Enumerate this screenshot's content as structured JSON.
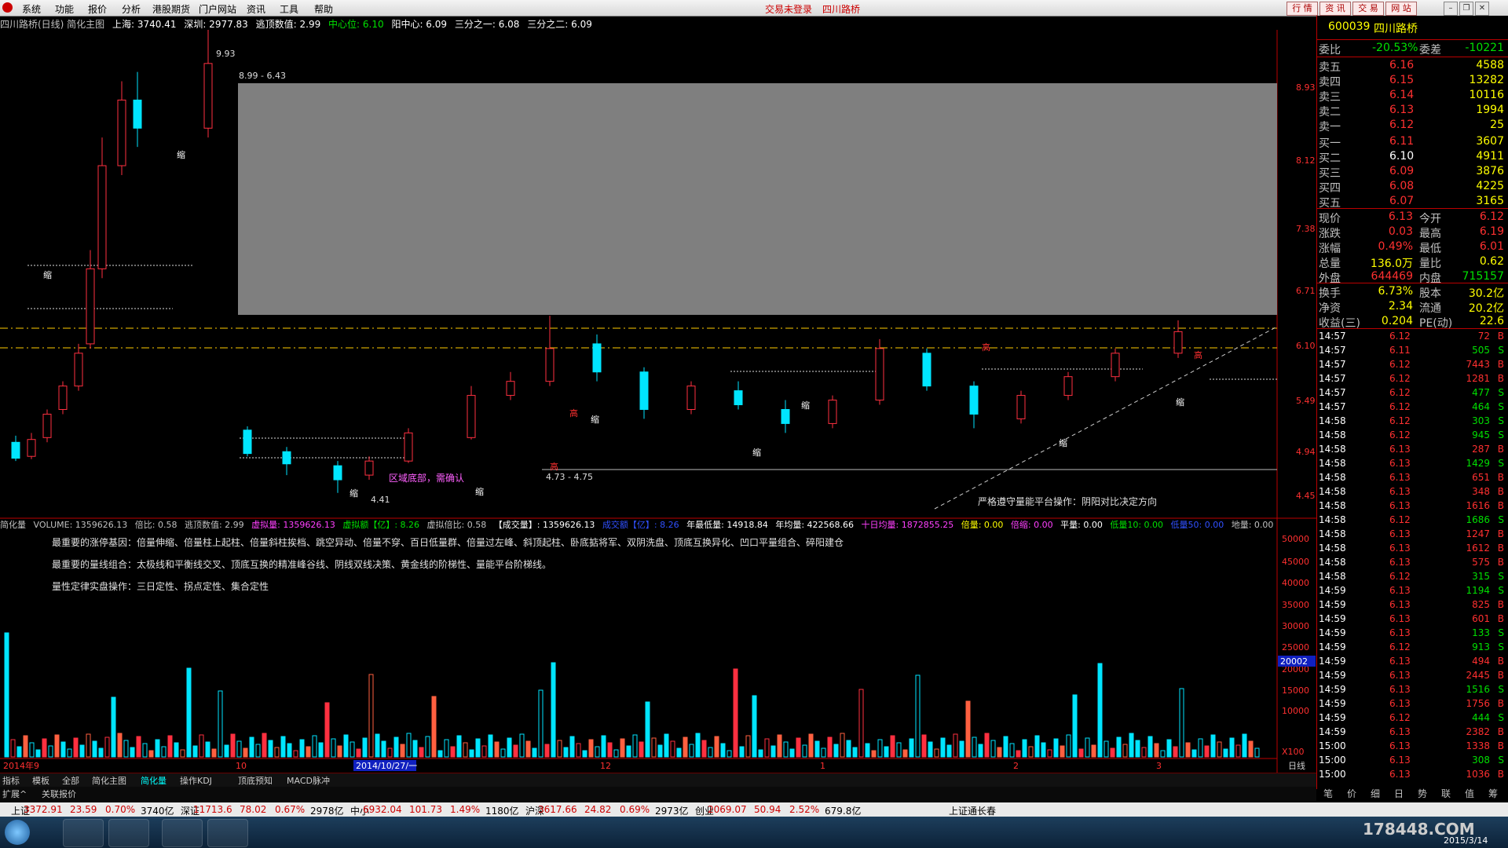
{
  "menu": {
    "items": [
      "系统",
      "功能",
      "报价",
      "分析",
      "港股期货",
      "门户网站",
      "资讯",
      "工具",
      "帮助"
    ],
    "status_left": "交易未登录",
    "status_right": "四川路桥",
    "right_buttons": [
      "行 情",
      "资 讯",
      "交 易",
      "网 站"
    ]
  },
  "chart_header": {
    "title": "四川路桥(日线) 简化主图",
    "shanghai": "上海: 3740.41",
    "shenzhen": "深圳: 2977.83",
    "escape": "逃顶数值: 2.99",
    "center": "中心位: 6.10",
    "yang_center": "阳中心: 6.09",
    "one_third": "三分之一: 6.08",
    "two_third": "三分之二: 6.09"
  },
  "price_axis": [
    "8.93",
    "8.12",
    "7.38",
    "6.71",
    "6.10",
    "5.49",
    "4.94",
    "4.45"
  ],
  "chart_annotations": {
    "range_top": "8.99 - 6.43",
    "range_bottom": "4.73 - 4.75",
    "low": "4.41",
    "bottom_region": "区域底部，需确认",
    "platform_note": "严格遵守量能平台操作：阴阳对比决定方向",
    "shrink": "缩",
    "high": "高",
    "peak_value": "9.93"
  },
  "volume_header": {
    "name": "简化量",
    "volume": "VOLUME: 1359626.13",
    "ratio": "倍比: 0.58",
    "escape": "逃顶数值: 2.99",
    "virtual_vol": "虚拟量: 1359626.13",
    "virtual_amt": "虚拟额【亿】: 8.26",
    "virtual_ratio": "虚拟倍比: 0.58",
    "deal_vol": "【成交量】: 1359626.13",
    "deal_amt": "成交额【亿】: 8.26",
    "year_low": "年最低量: 14918.84",
    "year_avg": "年均量: 422568.66",
    "ten_day": "十日均量: 1872855.25",
    "double": "倍量: 0.00",
    "shrink": "倍缩: 0.00",
    "flat": "平量: 0.00",
    "low10": "低量10: 0.00",
    "low50": "低量50: 0.00",
    "ground": "地量: 0.00"
  },
  "volume_notes": [
    "最重要的涨停基因：倍量伸缩、倍量柱上起柱、倍量斜柱挨档、跳空异动、倍量不穿、百日低量群、倍量过左峰、斜顶起柱、卧底掂将军、双阴洗盘、顶底互换异化、凹口平量组合、碎阳建仓",
    "最重要的量线组合：太极线和平衡线交叉、顶底互换的精准峰谷线、阴线双线决策、黄金线的阶梯性、量能平台阶梯线。",
    "量性定律实盘操作：三日定性、拐点定性、集合定性"
  ],
  "volume_axis": [
    "50000",
    "45000",
    "40000",
    "35000",
    "30000",
    "25000",
    "20000",
    "15000",
    "10000",
    "X100"
  ],
  "volume_marker": "20002",
  "date_axis": [
    "2014年9",
    "10",
    "2014/10/27/一",
    "12",
    "1",
    "2",
    "3",
    "日线"
  ],
  "tabs": [
    "指标",
    "模板",
    "全部",
    "简化主图",
    "简化量",
    "操作KDJ",
    "顶底预知",
    "MACD脉冲"
  ],
  "tabs2": [
    "扩展^",
    "关联报价"
  ],
  "right_panel": {
    "code": "600039",
    "name": "四川路桥",
    "weibi_label": "委比",
    "weibi_value": "-20.53%",
    "weicha_label": "委差",
    "weicha_value": "-10221",
    "sell": [
      {
        "label": "卖五",
        "price": "6.16",
        "vol": "4588"
      },
      {
        "label": "卖四",
        "price": "6.15",
        "vol": "13282"
      },
      {
        "label": "卖三",
        "price": "6.14",
        "vol": "10116"
      },
      {
        "label": "卖二",
        "price": "6.13",
        "vol": "1994"
      },
      {
        "label": "卖一",
        "price": "6.12",
        "vol": "25"
      }
    ],
    "buy": [
      {
        "label": "买一",
        "price": "6.11",
        "vol": "3607"
      },
      {
        "label": "买二",
        "price": "6.10",
        "vol": "4911"
      },
      {
        "label": "买三",
        "price": "6.09",
        "vol": "3876"
      },
      {
        "label": "买四",
        "price": "6.08",
        "vol": "4225"
      },
      {
        "label": "买五",
        "price": "6.07",
        "vol": "3165"
      }
    ],
    "quote": [
      {
        "l1": "现价",
        "v1": "6.13",
        "l2": "今开",
        "v2": "6.12"
      },
      {
        "l1": "涨跌",
        "v1": "0.03",
        "l2": "最高",
        "v2": "6.19"
      },
      {
        "l1": "涨幅",
        "v1": "0.49%",
        "l2": "最低",
        "v2": "6.01"
      },
      {
        "l1": "总量",
        "v1": "136.0万",
        "l2": "量比",
        "v2": "0.62"
      },
      {
        "l1": "外盘",
        "v1": "644469",
        "l2": "内盘",
        "v2": "715157"
      }
    ],
    "fund": [
      {
        "l1": "换手",
        "v1": "6.73%",
        "l2": "股本",
        "v2": "30.2亿"
      },
      {
        "l1": "净资",
        "v1": "2.34",
        "l2": "流通",
        "v2": "20.2亿"
      },
      {
        "l1": "收益(三)",
        "v1": "0.204",
        "l2": "PE(动)",
        "v2": "22.6"
      }
    ],
    "ticks": [
      {
        "t": "14:57",
        "p": "6.12",
        "v": "72",
        "d": "B"
      },
      {
        "t": "14:57",
        "p": "6.11",
        "v": "505",
        "d": "S"
      },
      {
        "t": "14:57",
        "p": "6.12",
        "v": "7443",
        "d": "B"
      },
      {
        "t": "14:57",
        "p": "6.12",
        "v": "1281",
        "d": "B"
      },
      {
        "t": "14:57",
        "p": "6.12",
        "v": "477",
        "d": "S"
      },
      {
        "t": "14:57",
        "p": "6.12",
        "v": "464",
        "d": "S"
      },
      {
        "t": "14:58",
        "p": "6.12",
        "v": "303",
        "d": "S"
      },
      {
        "t": "14:58",
        "p": "6.12",
        "v": "945",
        "d": "S"
      },
      {
        "t": "14:58",
        "p": "6.13",
        "v": "287",
        "d": "B"
      },
      {
        "t": "14:58",
        "p": "6.13",
        "v": "1429",
        "d": "S"
      },
      {
        "t": "14:58",
        "p": "6.13",
        "v": "651",
        "d": "B"
      },
      {
        "t": "14:58",
        "p": "6.13",
        "v": "348",
        "d": "B"
      },
      {
        "t": "14:58",
        "p": "6.13",
        "v": "1616",
        "d": "B"
      },
      {
        "t": "14:58",
        "p": "6.12",
        "v": "1686",
        "d": "S"
      },
      {
        "t": "14:58",
        "p": "6.13",
        "v": "1247",
        "d": "B"
      },
      {
        "t": "14:58",
        "p": "6.13",
        "v": "1612",
        "d": "B"
      },
      {
        "t": "14:58",
        "p": "6.13",
        "v": "575",
        "d": "B"
      },
      {
        "t": "14:58",
        "p": "6.12",
        "v": "315",
        "d": "S"
      },
      {
        "t": "14:59",
        "p": "6.13",
        "v": "1194",
        "d": "S"
      },
      {
        "t": "14:59",
        "p": "6.13",
        "v": "825",
        "d": "B"
      },
      {
        "t": "14:59",
        "p": "6.13",
        "v": "601",
        "d": "B"
      },
      {
        "t": "14:59",
        "p": "6.13",
        "v": "133",
        "d": "S"
      },
      {
        "t": "14:59",
        "p": "6.12",
        "v": "913",
        "d": "S"
      },
      {
        "t": "14:59",
        "p": "6.13",
        "v": "494",
        "d": "B"
      },
      {
        "t": "14:59",
        "p": "6.13",
        "v": "2445",
        "d": "B"
      },
      {
        "t": "14:59",
        "p": "6.13",
        "v": "1516",
        "d": "S"
      },
      {
        "t": "14:59",
        "p": "6.13",
        "v": "1756",
        "d": "B"
      },
      {
        "t": "14:59",
        "p": "6.12",
        "v": "444",
        "d": "S"
      },
      {
        "t": "14:59",
        "p": "6.13",
        "v": "2382",
        "d": "B"
      },
      {
        "t": "15:00",
        "p": "6.13",
        "v": "1338",
        "d": "B"
      },
      {
        "t": "15:00",
        "p": "6.13",
        "v": "308",
        "d": "S"
      },
      {
        "t": "15:00",
        "p": "6.13",
        "v": "1036",
        "d": "B"
      }
    ],
    "bottom_tabs": [
      "笔",
      "价",
      "细",
      "日",
      "势",
      "联",
      "值",
      "筹"
    ]
  },
  "ticker": [
    {
      "name": "上证",
      "value": "3372.91",
      "chg": "23.59",
      "pct": "0.70%",
      "amt": "3740亿"
    },
    {
      "name": "深证",
      "value": "11713.6",
      "chg": "78.02",
      "pct": "0.67%",
      "amt": "2978亿"
    },
    {
      "name": "中小",
      "value": "6932.04",
      "chg": "101.73",
      "pct": "1.49%",
      "amt": "1180亿"
    },
    {
      "name": "沪深",
      "value": "3617.66",
      "chg": "24.82",
      "pct": "0.69%",
      "amt": "2973亿"
    },
    {
      "name": "创业",
      "value": "2069.07",
      "chg": "50.94",
      "pct": "2.52%",
      "amt": "679.8亿"
    }
  ],
  "ticker_news": "上证通长春",
  "taskbar": {
    "date": "2015/3/14",
    "watermark": "178448.COM"
  },
  "chart_data": {
    "type": "candlestick",
    "title": "四川路桥(日线) 简化主图",
    "ylim": [
      4.45,
      8.93
    ],
    "candles_approx": [
      {
        "o": 4.95,
        "c": 4.78,
        "h": 5.02,
        "l": 4.75
      },
      {
        "o": 4.8,
        "c": 4.98,
        "h": 5.05,
        "l": 4.77
      },
      {
        "o": 5.0,
        "c": 5.25,
        "h": 5.3,
        "l": 4.95
      },
      {
        "o": 5.3,
        "c": 5.55,
        "h": 5.6,
        "l": 5.25
      },
      {
        "o": 5.55,
        "c": 5.9,
        "h": 6.0,
        "l": 5.5
      },
      {
        "o": 6.0,
        "c": 6.8,
        "h": 7.0,
        "l": 5.95
      },
      {
        "o": 6.8,
        "c": 7.9,
        "h": 8.2,
        "l": 6.7
      },
      {
        "o": 7.9,
        "c": 8.6,
        "h": 8.8,
        "l": 7.8
      },
      {
        "o": 8.6,
        "c": 8.3,
        "h": 8.9,
        "l": 8.1
      },
      {
        "o": 8.3,
        "c": 8.99,
        "h": 9.93,
        "l": 8.2
      },
      {
        "o": 5.08,
        "c": 4.83,
        "h": 5.12,
        "l": 4.8
      },
      {
        "o": 4.85,
        "c": 4.72,
        "h": 4.9,
        "l": 4.6
      },
      {
        "o": 4.7,
        "c": 4.55,
        "h": 4.75,
        "l": 4.41
      },
      {
        "o": 4.6,
        "c": 4.75,
        "h": 4.8,
        "l": 4.55
      },
      {
        "o": 4.75,
        "c": 5.05,
        "h": 5.1,
        "l": 4.73
      },
      {
        "o": 5.0,
        "c": 5.45,
        "h": 5.55,
        "l": 4.98
      },
      {
        "o": 5.45,
        "c": 5.6,
        "h": 5.7,
        "l": 5.4
      },
      {
        "o": 5.6,
        "c": 5.95,
        "h": 6.3,
        "l": 5.55
      },
      {
        "o": 6.0,
        "c": 5.7,
        "h": 6.1,
        "l": 5.6
      },
      {
        "o": 5.7,
        "c": 5.3,
        "h": 5.75,
        "l": 5.2
      },
      {
        "o": 5.3,
        "c": 5.55,
        "h": 5.6,
        "l": 5.25
      },
      {
        "o": 5.5,
        "c": 5.35,
        "h": 5.6,
        "l": 5.3
      },
      {
        "o": 5.3,
        "c": 5.15,
        "h": 5.4,
        "l": 5.05
      },
      {
        "o": 5.15,
        "c": 5.4,
        "h": 5.45,
        "l": 5.1
      },
      {
        "o": 5.4,
        "c": 5.95,
        "h": 6.05,
        "l": 5.35
      },
      {
        "o": 5.9,
        "c": 5.55,
        "h": 5.95,
        "l": 5.5
      },
      {
        "o": 5.55,
        "c": 5.25,
        "h": 5.6,
        "l": 5.1
      },
      {
        "o": 5.2,
        "c": 5.45,
        "h": 5.5,
        "l": 5.15
      },
      {
        "o": 5.45,
        "c": 5.65,
        "h": 5.7,
        "l": 5.4
      },
      {
        "o": 5.65,
        "c": 5.9,
        "h": 5.95,
        "l": 5.6
      },
      {
        "o": 5.9,
        "c": 6.13,
        "h": 6.25,
        "l": 5.85
      }
    ]
  }
}
